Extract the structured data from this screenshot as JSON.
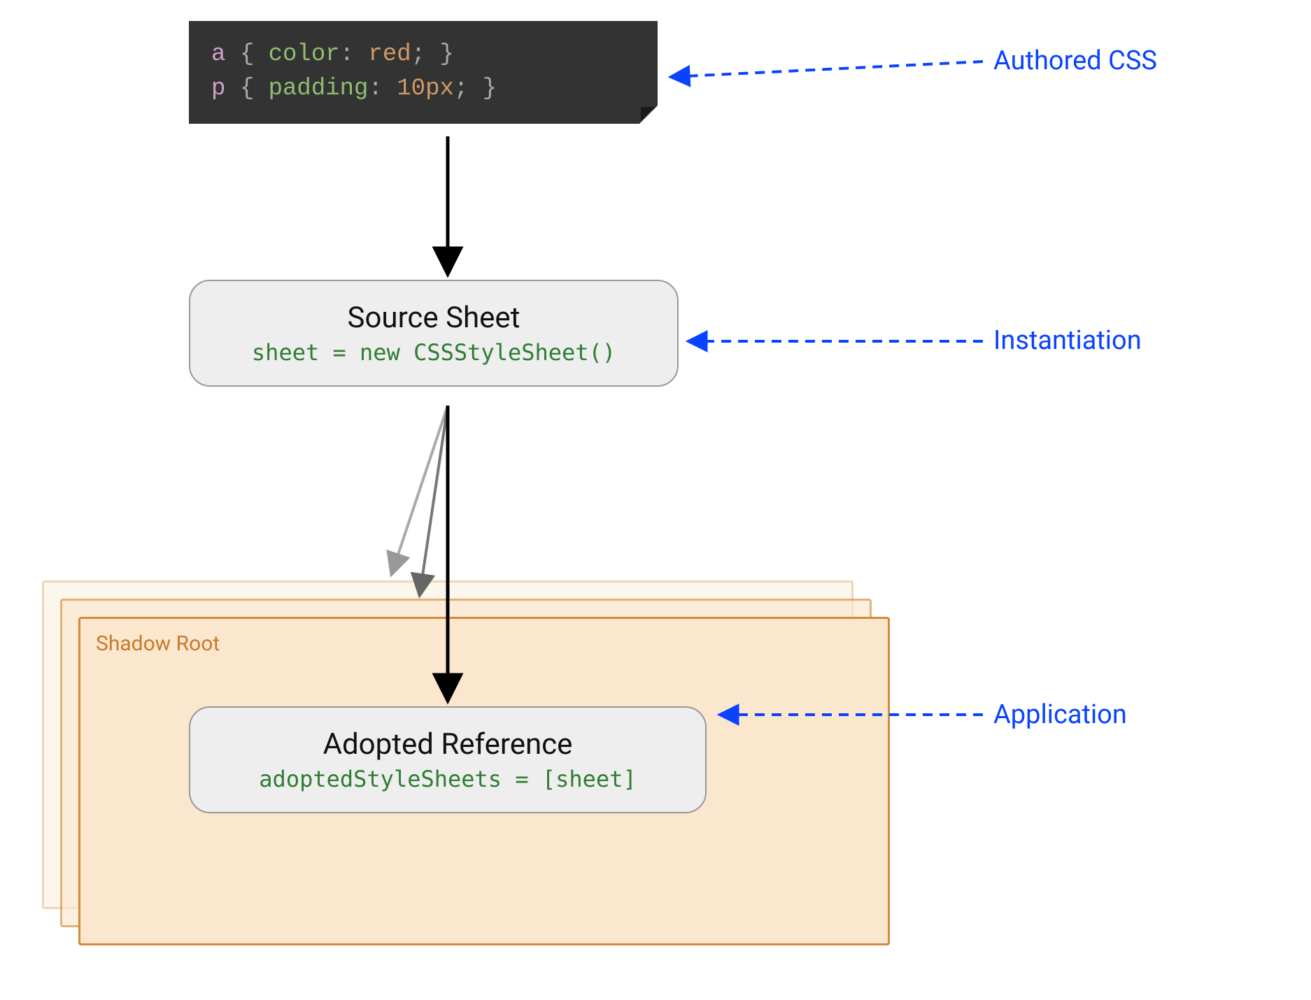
{
  "code": {
    "line1_selector": "a",
    "line1_prop": "color",
    "line1_val": "red",
    "line2_selector": "p",
    "line2_prop": "padding",
    "line2_val": "10px"
  },
  "source_sheet": {
    "title": "Source Sheet",
    "code": "sheet = new CSSStyleSheet()"
  },
  "shadow_root": {
    "label": "Shadow Root"
  },
  "adopted": {
    "title": "Adopted Reference",
    "code": "adoptedStyleSheets = [sheet]"
  },
  "annotations": {
    "authored": "Authored CSS",
    "instantiation": "Instantiation",
    "application": "Application"
  }
}
